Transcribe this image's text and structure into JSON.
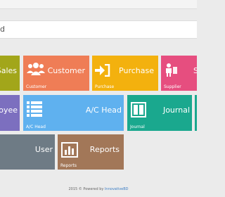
{
  "search": {
    "value": "d"
  },
  "tiles": {
    "sales": {
      "label": "Sales",
      "color": "#a2a61a"
    },
    "customer": {
      "label": "Customer",
      "sub": "Customer",
      "icon": "users-icon",
      "color": "#ef7d56"
    },
    "purchase": {
      "label": "Purchase",
      "sub": "Purchase",
      "icon": "sign-in-icon",
      "color": "#f3b10e"
    },
    "supplier": {
      "label": "S",
      "sub": "Supplier",
      "icon": "user-group-icon",
      "color": "#e64e7f"
    },
    "employee": {
      "label": "oyee",
      "color": "#7c6fbf"
    },
    "achead": {
      "label": "A/C Head",
      "sub": "A/C Head",
      "icon": "list-icon",
      "color": "#5fb1ef"
    },
    "journal": {
      "label": "Journal",
      "sub": "Journal",
      "icon": "columns-icon",
      "color": "#1aa88e"
    },
    "extra": {
      "color": "#1aa88e"
    },
    "user": {
      "label": "User",
      "color": "#6e7b85"
    },
    "reports": {
      "label": "Reports",
      "sub": "Reports",
      "icon": "bar-chart-icon",
      "color": "#a27758"
    }
  },
  "footer": {
    "text": "2015 © Powered by ",
    "link": "InnovativeBD"
  }
}
